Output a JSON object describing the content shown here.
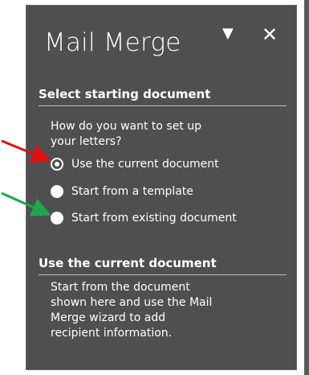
{
  "panel": {
    "title": "Mail Merge",
    "dropdown_icon": "▼",
    "close_icon": "✕",
    "section1": {
      "heading": "Select starting document",
      "question_line1": "How do you want to set up",
      "question_line2": "your letters?",
      "options": [
        {
          "label": "Use the current document",
          "selected": true
        },
        {
          "label": "Start from a template",
          "selected": false
        },
        {
          "label": "Start from existing document",
          "selected": false
        }
      ]
    },
    "section2": {
      "heading": "Use the current document",
      "lines": [
        "Start from the document",
        "shown here and use the Mail",
        "Merge wizard to add",
        "recipient information."
      ]
    }
  },
  "annotations": {
    "arrow1_color": "#e01010",
    "arrow2_color": "#1aa84a"
  }
}
